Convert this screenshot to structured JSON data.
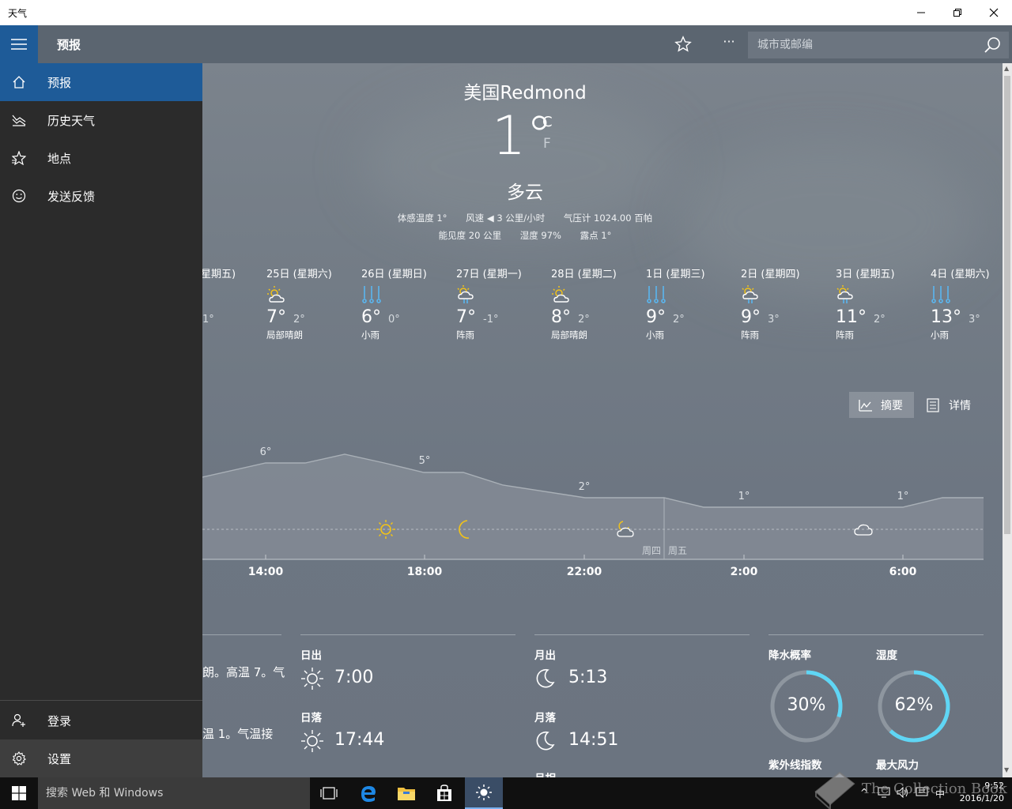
{
  "window": {
    "title": "天气"
  },
  "header": {
    "title": "预报",
    "search_placeholder": "城市或邮编",
    "more": "···"
  },
  "nav": {
    "items": [
      {
        "label": "预报",
        "icon": "home-icon"
      },
      {
        "label": "历史天气",
        "icon": "history-chart-icon"
      },
      {
        "label": "地点",
        "icon": "places-star-icon"
      },
      {
        "label": "发送反馈",
        "icon": "smiley-icon"
      }
    ],
    "bottom": [
      {
        "label": "登录",
        "icon": "person-add-icon"
      },
      {
        "label": "设置",
        "icon": "gear-icon"
      }
    ]
  },
  "current": {
    "city": "美国Redmond",
    "temp": "1°",
    "unit_c": "C",
    "unit_f": "F",
    "condition": "多云",
    "feels": "体感温度  1°",
    "wind": "风速  ◀ 3 公里/小时",
    "pressure": "气压计  1024.00 百帕",
    "visibility": "能见度  20 公里",
    "humidity": "湿度  97%",
    "dew": "露点  1°"
  },
  "forecast": [
    {
      "name": "星期五)",
      "hi": "",
      "lo": "1°",
      "desc": "",
      "icon": "none"
    },
    {
      "name": "25日 (星期六)",
      "hi": "7°",
      "lo": "2°",
      "desc": "局部晴朗",
      "icon": "partly-sunny-icon"
    },
    {
      "name": "26日 (星期日)",
      "hi": "6°",
      "lo": "0°",
      "desc": "小雨",
      "icon": "rain-icon"
    },
    {
      "name": "27日 (星期一)",
      "hi": "7°",
      "lo": "-1°",
      "desc": "阵雨",
      "icon": "showers-icon"
    },
    {
      "name": "28日 (星期二)",
      "hi": "8°",
      "lo": "2°",
      "desc": "局部晴朗",
      "icon": "partly-sunny-icon"
    },
    {
      "name": "1日 (星期三)",
      "hi": "9°",
      "lo": "2°",
      "desc": "小雨",
      "icon": "rain-icon"
    },
    {
      "name": "2日 (星期四)",
      "hi": "9°",
      "lo": "3°",
      "desc": "阵雨",
      "icon": "showers-icon"
    },
    {
      "name": "3日 (星期五)",
      "hi": "11°",
      "lo": "2°",
      "desc": "阵雨",
      "icon": "showers-icon"
    },
    {
      "name": "4日 (星期六)",
      "hi": "13°",
      "lo": "3°",
      "desc": "小雨",
      "icon": "rain-icon"
    }
  ],
  "toggles": {
    "summary": "摘要",
    "details": "详情"
  },
  "hourly": {
    "temp_labels": [
      "6°",
      "5°",
      "2°",
      "1°",
      "1°"
    ],
    "times": [
      "14:00",
      "18:00",
      "22:00",
      "2:00",
      "6:00"
    ],
    "day_left": "周四",
    "day_right": "周五"
  },
  "day_details": {
    "text1": "朗。高温 7。气",
    "text2": "温 1。气温接",
    "sunrise_label": "日出",
    "sunrise": "7:00",
    "sunset_label": "日落",
    "sunset": "17:44",
    "moonrise_label": "月出",
    "moonrise": "5:13",
    "moonset_label": "月落",
    "moonset": "14:51",
    "moonphase_label": "月相",
    "precip_label": "降水概率",
    "precip": "30%",
    "precip_value": 0.3,
    "humidity_label": "湿度",
    "humidity": "62%",
    "humidity_value": 0.62,
    "uv_label": "紫外线指数",
    "wind_label": "最大风力"
  },
  "taskbar": {
    "search": "搜索 Web 和 Windows",
    "time": "9:52",
    "date": "2016/1/20",
    "ime": "中"
  },
  "watermark": "The Collection Book",
  "colors": {
    "accent": "#1e5b98",
    "ring": "#5fd6f5",
    "sun": "#f2c318"
  }
}
